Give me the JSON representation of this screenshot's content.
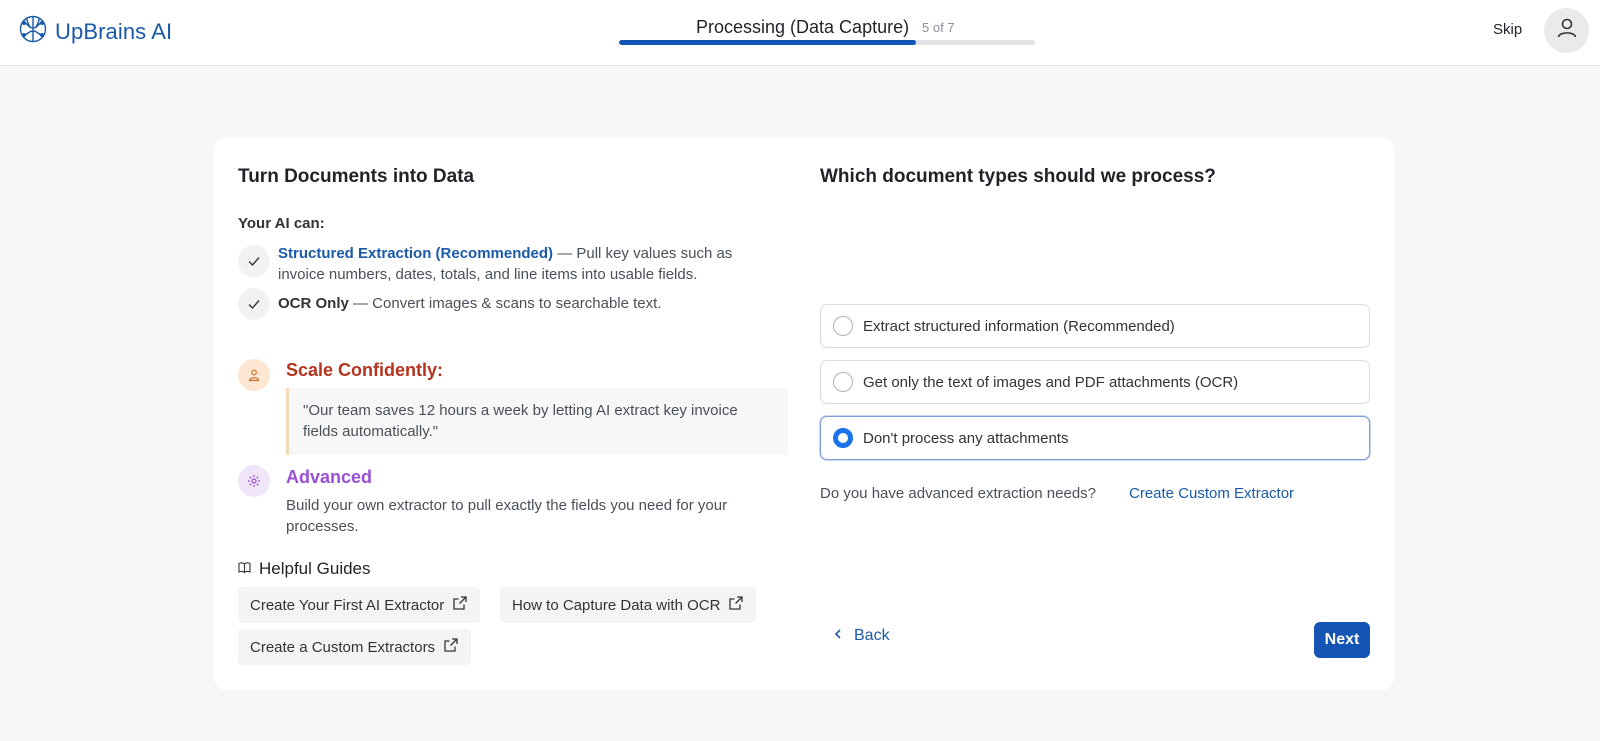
{
  "header": {
    "brand": "UpBrains AI",
    "progress_title": "Processing (Data Capture)",
    "progress_step": "5 of 7",
    "progress_fraction": 0.714,
    "skip_label": "Skip"
  },
  "left": {
    "title": "Turn Documents into Data",
    "ai_can": "Your AI can:",
    "features": [
      {
        "highlight": "Structured Extraction (Recommended)",
        "text": " — Pull key values such as invoice numbers, dates, totals, and line items into usable fields."
      },
      {
        "highlight": "OCR Only",
        "text": " — Convert images & scans to searchable text."
      }
    ],
    "scale_title": "Scale Confidently:",
    "quote": "\"Our team saves 12 hours a week by letting AI extract key invoice fields automatically.\"",
    "advanced_title": "Advanced",
    "advanced_desc": "Build your own extractor to pull exactly the fields you need for your processes.",
    "guides_title": "Helpful Guides",
    "guides": [
      "Create Your First AI Extractor",
      "How to Capture Data with OCR",
      "Create a Custom Extractors"
    ]
  },
  "right": {
    "title": "Which document types should we process?",
    "options": [
      {
        "label": "Extract structured information (Recommended)",
        "selected": false
      },
      {
        "label": "Get only the text of images and PDF attachments (OCR)",
        "selected": false
      },
      {
        "label": "Don't process any attachments",
        "selected": true
      }
    ],
    "advanced_question": "Do you have advanced extraction needs?",
    "custom_link": "Create Custom Extractor"
  },
  "nav": {
    "back_label": "Back",
    "next_label": "Next"
  },
  "colors": {
    "accent": "#1354b4",
    "link": "#1a5aa8",
    "scale": "#b5341f",
    "advanced": "#9a4fd6"
  },
  "icons": {
    "brand": "brain-circuit-icon",
    "avatar": "user-icon",
    "check": "check-icon",
    "scale": "person-icon",
    "advanced": "gear-icon",
    "guides": "book-icon",
    "external": "external-link-icon",
    "back": "chevron-left-icon"
  }
}
